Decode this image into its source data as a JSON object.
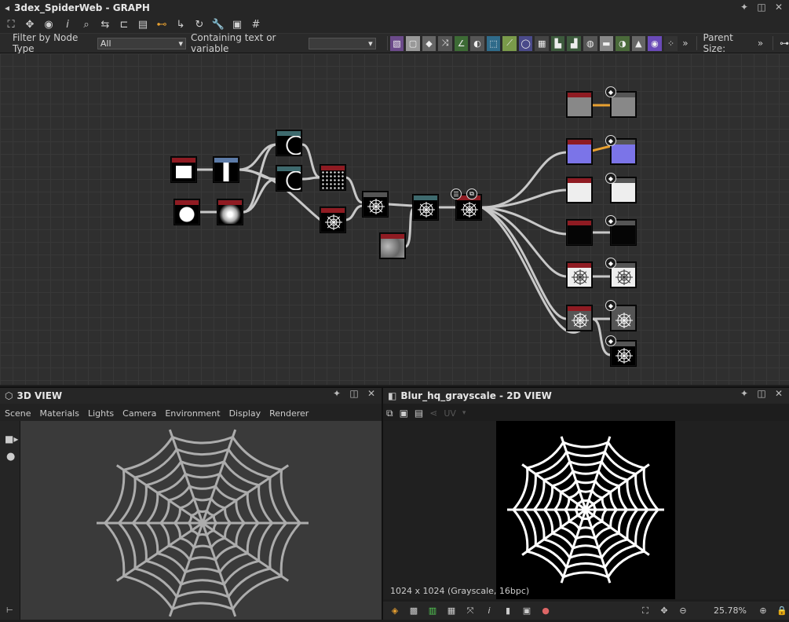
{
  "graph_window": {
    "title": "3dex_SpiderWeb - GRAPH",
    "header_icons": [
      "pin-icon",
      "maximize-icon",
      "close-icon"
    ],
    "toolbar_icons": [
      "fit-view-icon",
      "pan-icon",
      "screenshot-icon",
      "info-icon",
      "search-icon",
      "nodes-icon",
      "hierarchy-icon",
      "stack-icon",
      "link-icon",
      "connector-icon",
      "cycle-icon",
      "wrench-icon",
      "frame-icon",
      "grid-icon"
    ]
  },
  "filter_bar": {
    "filter_label": "Filter by Node Type",
    "filter_value": "All",
    "containing_label": "Containing text or variable",
    "containing_value": "",
    "node_type_icons": [
      "bitmap",
      "uniform",
      "levels",
      "transform",
      "curve",
      "blend",
      "tile",
      "warp",
      "normal",
      "ao",
      "grid",
      "vector",
      "compose",
      "gradient",
      "blur",
      "pattern",
      "histogram",
      "color",
      "dots"
    ],
    "more_icon": "»",
    "parent_size_label": "Parent Size:",
    "parent_size_icon": "»",
    "connect_icon": "connect-icon"
  },
  "graph_nodes": [
    {
      "id": "n1",
      "cap": "#8f1b22",
      "thumb": "square"
    },
    {
      "id": "n2",
      "cap": "#5c7ba8",
      "thumb": "bar"
    },
    {
      "id": "n3",
      "cap": "#8f1b22",
      "thumb": "disc"
    },
    {
      "id": "n4",
      "cap": "#8f1b22",
      "thumb": "glow"
    },
    {
      "id": "n5",
      "cap": "#3e6a6e",
      "thumb": "arc"
    },
    {
      "id": "n6",
      "cap": "#3e6a6e",
      "thumb": "arc"
    },
    {
      "id": "n7",
      "cap": "#8f1b22",
      "thumb": "dots"
    },
    {
      "id": "n8",
      "cap": "#8f1b22",
      "thumb": "web-dark"
    },
    {
      "id": "n9",
      "cap": "#555",
      "thumb": "web-dark"
    },
    {
      "id": "n10",
      "cap": "#8f1b22",
      "thumb": "noise"
    },
    {
      "id": "n11",
      "cap": "#3e6a6e",
      "thumb": "web-dark"
    },
    {
      "id": "n12",
      "cap": "#8f1b22",
      "thumb": "web-dark"
    },
    {
      "id": "o1a",
      "cap": "#8f1b22",
      "thumb": "grey"
    },
    {
      "id": "o1b",
      "cap": "#555",
      "thumb": "grey"
    },
    {
      "id": "o2a",
      "cap": "#8f1b22",
      "thumb": "blue"
    },
    {
      "id": "o2b",
      "cap": "#555",
      "thumb": "blue"
    },
    {
      "id": "o3a",
      "cap": "#8f1b22",
      "thumb": "white"
    },
    {
      "id": "o3b",
      "cap": "#555",
      "thumb": "white"
    },
    {
      "id": "o4a",
      "cap": "#8f1b22",
      "thumb": "black"
    },
    {
      "id": "o4b",
      "cap": "#555",
      "thumb": "black"
    },
    {
      "id": "o5a",
      "cap": "#8f1b22",
      "thumb": "web-light"
    },
    {
      "id": "o5b",
      "cap": "#555",
      "thumb": "web-light"
    },
    {
      "id": "o6a",
      "cap": "#8f1b22",
      "thumb": "web-grey"
    },
    {
      "id": "o6b",
      "cap": "#555",
      "thumb": "web-grey"
    },
    {
      "id": "o7b",
      "cap": "#555",
      "thumb": "web-dark"
    }
  ],
  "view3d": {
    "title": "3D VIEW",
    "menu": [
      "Scene",
      "Materials",
      "Lights",
      "Camera",
      "Environment",
      "Display",
      "Renderer"
    ],
    "side_icons": [
      "camera-icon",
      "light-icon"
    ]
  },
  "view2d": {
    "title": "Blur_hq_grayscale - 2D VIEW",
    "uv_label": "UV",
    "info": "1024 x 1024 (Grayscale, 16bpc)",
    "zoom": "25.78%"
  },
  "colors": {
    "accent_orange": "#e8a030",
    "link_grey": "#c8c8c8",
    "output_cap": "#8f1b22"
  }
}
